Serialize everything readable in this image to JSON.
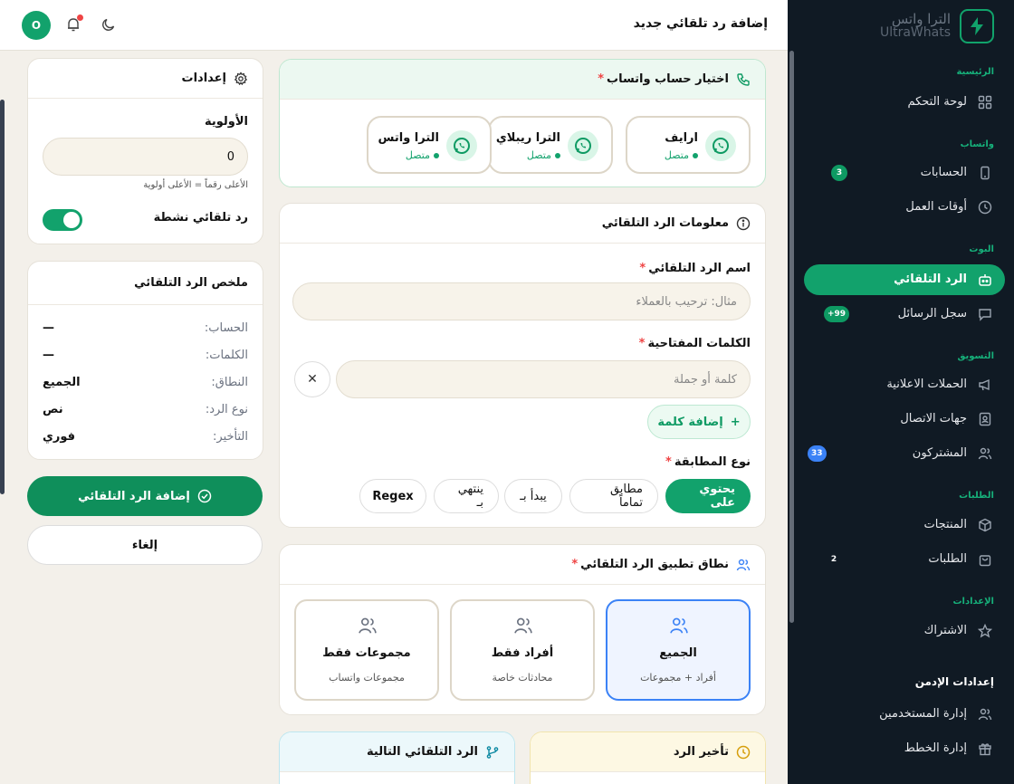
{
  "brand": {
    "name_ar": "الترا واتس",
    "name_en": "UltraWhats"
  },
  "sidebar": {
    "sections": {
      "main": "الرئيسية",
      "whatsapp": "واتساب",
      "bot": "البوت",
      "marketing": "التسويق",
      "orders": "الطلبات",
      "settings": "الإعدادات"
    },
    "items": {
      "dashboard": "لوحة التحكم",
      "accounts": "الحسابات",
      "accounts_badge": "3",
      "work_hours": "أوقات العمل",
      "auto_reply": "الرد التلقائي",
      "messages_log": "سجل الرسائل",
      "messages_badge": "99+",
      "campaigns": "الحملات الاعلانية",
      "contacts": "جهات الاتصال",
      "subscribers": "المشتركون",
      "subscribers_badge": "33",
      "products": "المنتجات",
      "orders": "الطلبات",
      "orders_badge": "2",
      "subscription": "الاشتراك"
    },
    "admin": {
      "title": "إعدادات الإدمن",
      "users": "إدارة المستخدمين",
      "plans": "إدارة الخطط"
    }
  },
  "header": {
    "title": "إضافة رد تلقائي جديد",
    "avatar": "O"
  },
  "account_card": {
    "title": "اختيار حساب واتساب",
    "accounts": [
      {
        "name": "ارايف",
        "status": "متصل"
      },
      {
        "name": "الترا ريبلاي",
        "status": "متصل"
      },
      {
        "name": "الترا واتس",
        "status": "متصل"
      }
    ]
  },
  "info_card": {
    "title": "معلومات الرد التلقائي",
    "name_label": "اسم الرد التلقائي",
    "name_placeholder": "مثال: ترحيب بالعملاء",
    "keywords_label": "الكلمات المفتاحية",
    "keyword_placeholder": "كلمة أو جملة",
    "add_keyword": "إضافة كلمة",
    "match_label": "نوع المطابقة",
    "match_types": [
      "يحتوي على",
      "مطابق تماماً",
      "يبدأ بـ",
      "ينتهي بـ",
      "Regex"
    ]
  },
  "scope_card": {
    "title": "نطاق تطبيق الرد التلقائي",
    "options": [
      {
        "name": "الجميع",
        "desc": "أفراد + مجموعات"
      },
      {
        "name": "أفراد فقط",
        "desc": "محادثات خاصة"
      },
      {
        "name": "مجموعات فقط",
        "desc": "مجموعات واتساب"
      }
    ]
  },
  "delay_card": {
    "title": "تأخير الرد"
  },
  "next_card": {
    "title": "الرد التلقائي التالية"
  },
  "settings_card": {
    "title": "إعدادات",
    "priority_label": "الأولوية",
    "priority_value": "0",
    "priority_hint": "الأعلى رقماً = الأعلى أولوية",
    "active_label": "رد تلقائي نشطة"
  },
  "summary_card": {
    "title": "ملخص الرد التلقائي",
    "rows": [
      {
        "k": "الحساب:",
        "v": "—"
      },
      {
        "k": "الكلمات:",
        "v": "—"
      },
      {
        "k": "النطاق:",
        "v": "الجميع"
      },
      {
        "k": "نوع الرد:",
        "v": "نص"
      },
      {
        "k": "التأخير:",
        "v": "فوري"
      }
    ]
  },
  "actions": {
    "submit": "إضافة الرد التلقائي",
    "cancel": "إلغاء"
  },
  "colors": {
    "accent": "#12a26c",
    "sidebar": "#101a24",
    "blue": "#3b82f6"
  }
}
